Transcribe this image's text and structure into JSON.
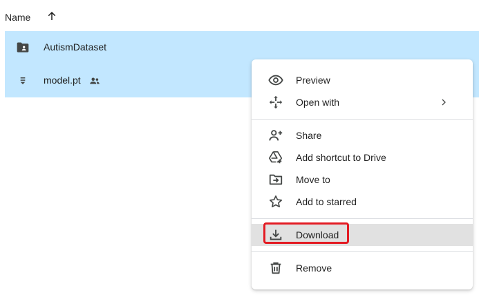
{
  "header": {
    "name_label": "Name",
    "sort_icon": "arrow-up-icon"
  },
  "files": [
    {
      "name": "AutismDataset",
      "icon": "shared-folder-icon",
      "shared": false
    },
    {
      "name": "model.pt",
      "icon": "file-lines-icon",
      "shared": true
    }
  ],
  "menu": {
    "items": [
      {
        "label": "Preview",
        "icon": "eye-icon"
      },
      {
        "label": "Open with",
        "icon": "move-arrows-icon",
        "submenu": true
      },
      {
        "label": "Share",
        "icon": "person-add-icon"
      },
      {
        "label": "Add shortcut to Drive",
        "icon": "drive-shortcut-icon"
      },
      {
        "label": "Move to",
        "icon": "folder-move-icon"
      },
      {
        "label": "Add to starred",
        "icon": "star-icon"
      },
      {
        "label": "Download",
        "icon": "download-icon",
        "highlighted": true
      },
      {
        "label": "Remove",
        "icon": "trash-icon"
      }
    ]
  },
  "colors": {
    "selection": "#c2e7ff",
    "menu_hover": "#e1e1e1",
    "highlight_box": "#e31b23",
    "icon": "#444746"
  }
}
